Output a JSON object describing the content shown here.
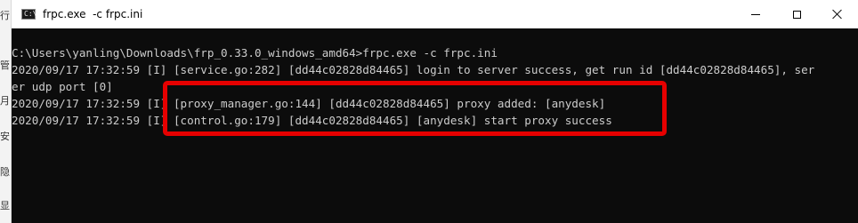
{
  "background_window": {
    "edge_chars": [
      "行",
      "管",
      "月",
      "安",
      "隐",
      "显"
    ]
  },
  "window": {
    "title": "frpc.exe  -c frpc.ini",
    "icon": "console-icon",
    "controls": {
      "minimize_icon": "minimize-icon",
      "maximize_icon": "maximize-icon",
      "close_icon": "close-icon"
    }
  },
  "console": {
    "lines": [
      "C:\\Users\\yanling\\Downloads\\frp_0.33.0_windows_amd64>frpc.exe -c frpc.ini",
      "2020/09/17 17:32:59 [I] [service.go:282] [dd44c02828d84465] login to server success, get run id [dd44c02828d84465], ser",
      "er udp port [0]",
      "2020/09/17 17:32:59 [I] [proxy_manager.go:144] [dd44c02828d84465] proxy added: [anydesk]",
      "2020/09/17 17:32:59 [I] [control.go:179] [dd44c02828d84465] [anydesk] start proxy success"
    ],
    "colors": {
      "background": "#0c0c0c",
      "text": "#cccccc",
      "highlight": "#e60000"
    }
  }
}
